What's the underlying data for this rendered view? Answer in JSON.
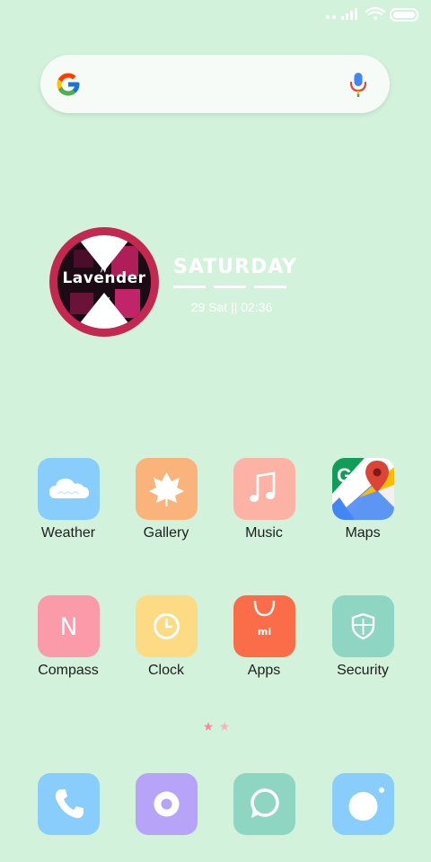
{
  "widget": {
    "label": "Lavender",
    "day": "SATURDAY",
    "datetime": "29 Sat || 02:36"
  },
  "apps": [
    {
      "label": "Weather",
      "icon": "cloud-icon",
      "color": "#88cdfc"
    },
    {
      "label": "Gallery",
      "icon": "leaf-icon",
      "color": "#fbb37c"
    },
    {
      "label": "Music",
      "icon": "music-note-icon",
      "color": "#fcb3a6"
    },
    {
      "label": "Maps",
      "icon": "google-maps-icon",
      "color": "#34a853"
    },
    {
      "label": "Compass",
      "icon": "n-letter-icon",
      "color": "#fb9aa8"
    },
    {
      "label": "Clock",
      "icon": "clock-icon",
      "color": "#fcdb84"
    },
    {
      "label": "Apps",
      "icon": "shopping-bag-icon",
      "color": "#fb6d49"
    },
    {
      "label": "Security",
      "icon": "shield-icon",
      "color": "#8ed6c2"
    }
  ],
  "dock": [
    {
      "icon": "phone-icon",
      "color": "#88cdfc"
    },
    {
      "icon": "ring-icon",
      "color": "#b7a4f9"
    },
    {
      "icon": "chat-bubble-icon",
      "color": "#8ed6c2"
    },
    {
      "icon": "camera-icon",
      "color": "#88cdfc"
    }
  ],
  "colors": {
    "wallpaper": "#d3f2dc",
    "page_dot_active": "#fb8a98",
    "page_dot_inactive": "#f5b4bc"
  }
}
